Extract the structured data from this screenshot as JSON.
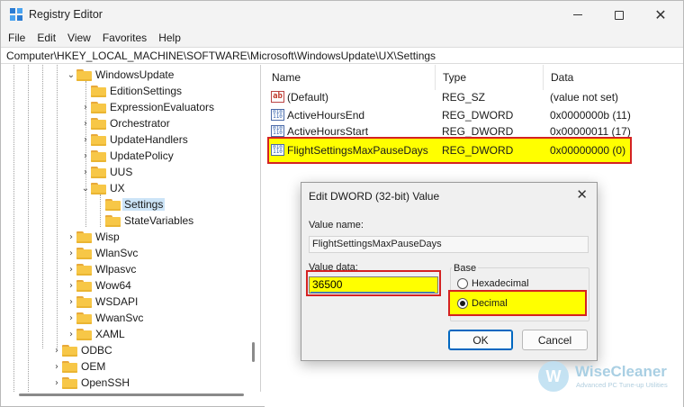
{
  "window": {
    "title": "Registry Editor",
    "close_glyph": "✕"
  },
  "menu": [
    "File",
    "Edit",
    "View",
    "Favorites",
    "Help"
  ],
  "address": "Computer\\HKEY_LOCAL_MACHINE\\SOFTWARE\\Microsoft\\WindowsUpdate\\UX\\Settings",
  "tree": {
    "items": [
      {
        "label": "WindowsUpdate",
        "expanded": true
      },
      {
        "label": "EditionSettings"
      },
      {
        "label": "ExpressionEvaluators"
      },
      {
        "label": "Orchestrator"
      },
      {
        "label": "UpdateHandlers"
      },
      {
        "label": "UpdatePolicy"
      },
      {
        "label": "UUS"
      },
      {
        "label": "UX",
        "expanded": true
      },
      {
        "label": "Settings",
        "selected": true
      },
      {
        "label": "StateVariables"
      },
      {
        "label": "Wisp"
      },
      {
        "label": "WlanSvc"
      },
      {
        "label": "Wlpasvc"
      },
      {
        "label": "Wow64"
      },
      {
        "label": "WSDAPI"
      },
      {
        "label": "WwanSvc"
      },
      {
        "label": "XAML"
      },
      {
        "label": "ODBC"
      },
      {
        "label": "OEM"
      },
      {
        "label": "OpenSSH"
      }
    ],
    "chevron_right": "›",
    "chevron_down": "⌄"
  },
  "list": {
    "columns": [
      "Name",
      "Type",
      "Data"
    ],
    "rows": [
      {
        "name": "(Default)",
        "type": "REG_SZ",
        "data": "(value not set)",
        "icon": "string-value-icon"
      },
      {
        "name": "ActiveHoursEnd",
        "type": "REG_DWORD",
        "data": "0x0000000b (11)",
        "icon": "binary-value-icon"
      },
      {
        "name": "ActiveHoursStart",
        "type": "REG_DWORD",
        "data": "0x00000011 (17)",
        "icon": "binary-value-icon"
      },
      {
        "name": "FlightSettingsMaxPauseDays",
        "type": "REG_DWORD",
        "data": "0x00000000 (0)",
        "icon": "binary-value-icon",
        "highlighted": true
      }
    ]
  },
  "dialog": {
    "title": "Edit DWORD (32-bit) Value",
    "value_name_label": "Value name:",
    "value_name": "FlightSettingsMaxPauseDays",
    "value_data_label": "Value data:",
    "value_data": "36500",
    "base_label": "Base",
    "hex_label": "Hexadecimal",
    "dec_label": "Decimal",
    "selected_base": "Decimal",
    "ok_label": "OK",
    "cancel_label": "Cancel",
    "close_glyph": "✕"
  },
  "watermark": {
    "logo_letter": "W",
    "name": "WiseCleaner",
    "tagline": "Advanced PC Tune-up Utilities"
  },
  "colors": {
    "highlight": "#ffff00",
    "annotation_border": "#d42222",
    "selection": "#cce4f7",
    "folder": "#f7c747"
  }
}
